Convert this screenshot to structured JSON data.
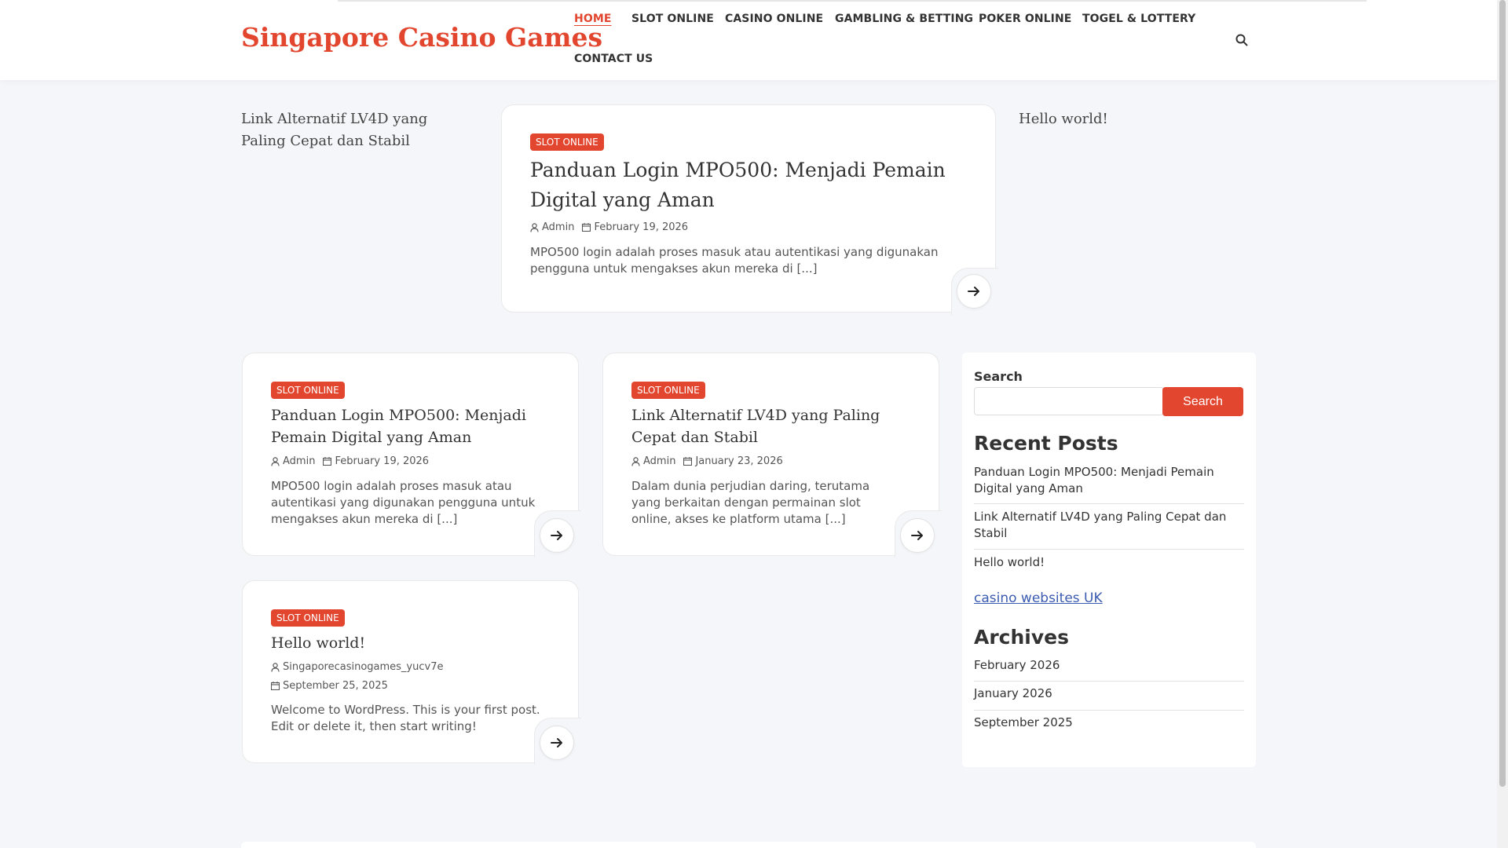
{
  "header": {
    "site_title": "Singapore Casino Games",
    "nav": [
      {
        "label": "HOME",
        "active": true
      },
      {
        "label": "SLOT ONLINE"
      },
      {
        "label": "CASINO ONLINE"
      },
      {
        "label": "GAMBLING & BETTING"
      },
      {
        "label": "POKER ONLINE"
      },
      {
        "label": "TOGEL & LOTTERY"
      },
      {
        "label": "CONTACT US"
      }
    ],
    "search_icon": "search-icon"
  },
  "featured": {
    "left_link": "Link Alternatif LV4D yang Paling Cepat dan Stabil",
    "right_link": "Hello world!",
    "card": {
      "category": "SLOT ONLINE",
      "title": "Panduan Login MPO500: Menjadi Pemain Digital yang Aman",
      "author": "Admin",
      "date": "February 19, 2026",
      "excerpt": "MPO500 login adalah proses masuk atau autentikasi yang digunakan pengguna untuk mengakses akun mereka di [...]"
    }
  },
  "posts": [
    {
      "category": "SLOT ONLINE",
      "title": "Panduan Login MPO500: Menjadi Pemain Digital yang Aman",
      "author": "Admin",
      "date": "February 19, 2026",
      "excerpt": "MPO500 login adalah proses masuk atau autentikasi yang digunakan pengguna untuk mengakses akun mereka di [...]"
    },
    {
      "category": "SLOT ONLINE",
      "title": "Link Alternatif LV4D yang Paling Cepat dan Stabil",
      "author": "Admin",
      "date": "January 23, 2026",
      "excerpt": "Dalam dunia perjudian daring, terutama yang berkaitan dengan permainan slot online, akses ke platform utama [...]"
    },
    {
      "category": "SLOT ONLINE",
      "title": "Hello world!",
      "author": "Singaporecasinogames_yucv7e",
      "date": "September 25, 2025",
      "excerpt": "Welcome to WordPress. This is your first post. Edit or delete it, then start writing!"
    }
  ],
  "sidebar": {
    "search_label": "Search",
    "search_value": "",
    "search_button": "Search",
    "recent_heading": "Recent Posts",
    "recent": [
      "Panduan Login MPO500: Menjadi Pemain Digital yang Aman",
      "Link Alternatif LV4D yang Paling Cepat dan Stabil",
      "Hello world!"
    ],
    "external_link": "casino websites UK",
    "archives_heading": "Archives",
    "archives": [
      "February 2026",
      "January 2026",
      "September 2025"
    ]
  },
  "colors": {
    "accent": "#e2462f",
    "link": "#3b5bb0",
    "background": "#f4f6f9"
  }
}
